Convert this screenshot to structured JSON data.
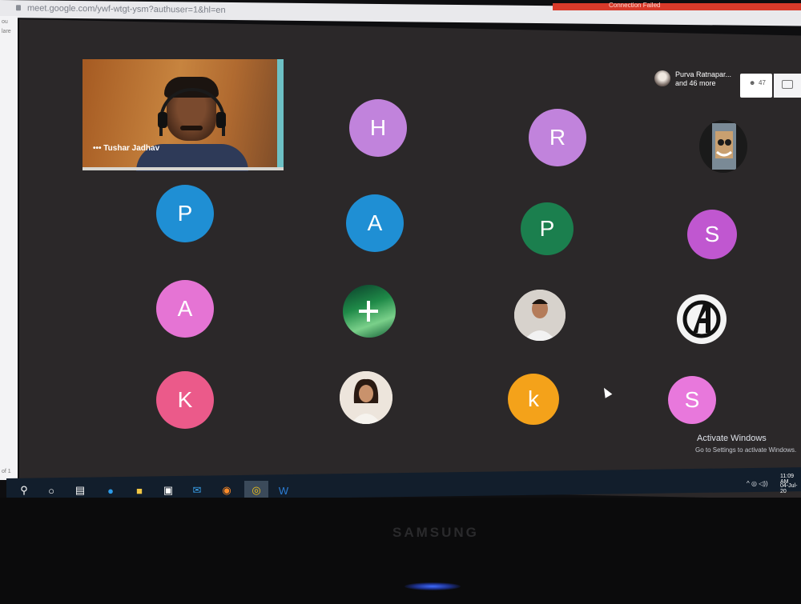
{
  "browser": {
    "url": "meet.google.com/ywf-wtgt-ysm?authuser=1&hl=en",
    "notification": "Connection Failed"
  },
  "left_edge": {
    "labels": [
      "ou",
      "lare"
    ],
    "page_indicator": "of 1"
  },
  "meet": {
    "presenter": {
      "name_line1": "Purva Ratnapar...",
      "name_line2": "and 46 more"
    },
    "people_count": "47",
    "self_view": {
      "name": "Tushar Jadhav",
      "menu": "•••"
    },
    "participants": [
      {
        "letter": "H",
        "color": "#c183dc"
      },
      {
        "letter": "R",
        "color": "#c183dc"
      },
      {
        "letter": "P",
        "color": "#1f8fd4"
      },
      {
        "letter": "A",
        "color": "#1f8fd4"
      },
      {
        "letter": "P",
        "color": "#1b7f4e"
      },
      {
        "letter": "S",
        "color": "#c057d0"
      },
      {
        "letter": "A",
        "color": "#e574d4"
      },
      {
        "letter": "K",
        "color": "#eb5a8a"
      },
      {
        "letter": "k",
        "color": "#f4a21a"
      },
      {
        "letter": "S",
        "color": "#e878dc"
      }
    ]
  },
  "windows": {
    "activate_title": "Activate Windows",
    "activate_sub": "Go to Settings to activate Windows.",
    "clock_time": "11:09 AM",
    "clock_date": "04-Jul-20",
    "tray": "^ ◎ ◁))"
  },
  "taskbar": {
    "icons": [
      "search-icon",
      "cortana-icon",
      "task-view-icon",
      "edge-icon",
      "file-explorer-icon",
      "store-icon",
      "mail-icon",
      "firefox-icon",
      "chrome-icon",
      "word-icon"
    ]
  },
  "monitor": {
    "brand": "SAMSUNG"
  }
}
